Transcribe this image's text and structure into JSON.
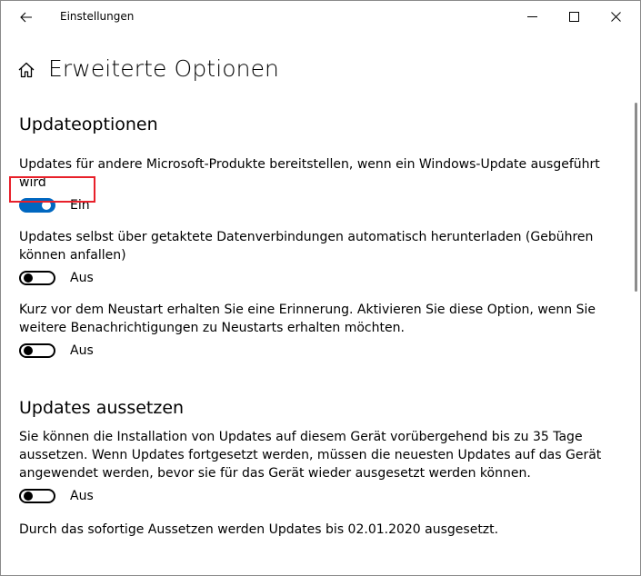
{
  "window": {
    "title": "Einstellungen",
    "controls": [
      "minimize",
      "maximize",
      "close"
    ]
  },
  "page": {
    "title": "Erweiterte Optionen"
  },
  "sections": [
    {
      "title": "Updateoptionen",
      "options": [
        {
          "description": "Updates für andere Microsoft-Produkte bereitstellen, wenn ein Windows-Update ausgeführt wird",
          "state_label": "Ein",
          "on": true
        },
        {
          "description": "Updates selbst über getaktete Datenverbindungen automatisch herunterladen (Gebühren können anfallen)",
          "state_label": "Aus",
          "on": false
        },
        {
          "description": "Kurz vor dem Neustart erhalten Sie eine Erinnerung. Aktivieren Sie diese Option, wenn Sie weitere Benachrichtigungen zu Neustarts erhalten möchten.",
          "state_label": "Aus",
          "on": false
        }
      ]
    },
    {
      "title": "Updates aussetzen",
      "description": "Sie können die Installation von Updates auf diesem Gerät vorübergehend bis zu 35 Tage aussetzen. Wenn Updates fortgesetzt werden, müssen die neuesten Updates auf das Gerät angewendet werden, bevor sie für das Gerät wieder ausgesetzt werden können.",
      "state_label": "Aus",
      "on": false,
      "footnote": "Durch das sofortige Aussetzen werden Updates bis 02.01.2020 ausgesetzt."
    }
  ],
  "colors": {
    "toggle_on": "#0067c0",
    "highlight": "#e8202a"
  }
}
